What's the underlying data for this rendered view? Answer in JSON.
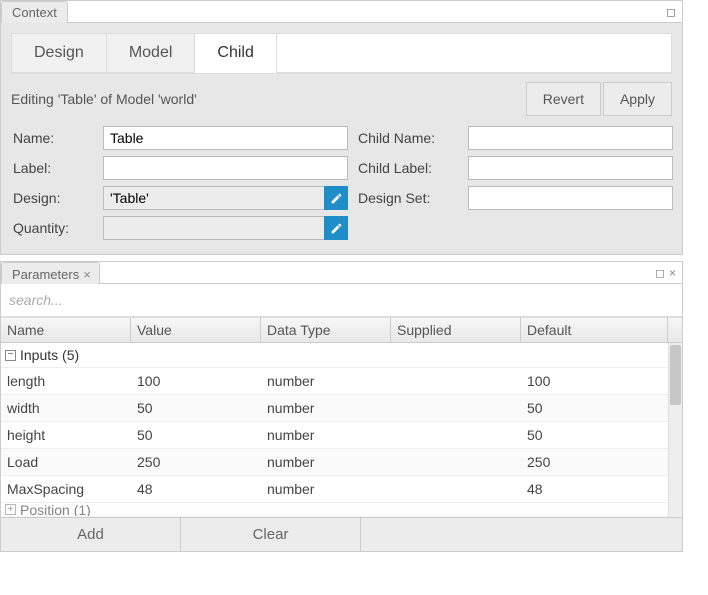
{
  "context": {
    "tab_label": "Context",
    "box_glyph": "◻"
  },
  "inner_tabs": [
    {
      "label": "Design",
      "active": false
    },
    {
      "label": "Model",
      "active": false
    },
    {
      "label": "Child",
      "active": true
    }
  ],
  "editing_text": "Editing 'Table' of Model 'world'",
  "buttons": {
    "revert": "Revert",
    "apply": "Apply",
    "add": "Add",
    "clear": "Clear"
  },
  "fields": {
    "name_label": "Name:",
    "name_value": "Table",
    "label_label": "Label:",
    "label_value": "",
    "design_label": "Design:",
    "design_value": "'Table'",
    "quantity_label": "Quantity:",
    "quantity_value": "",
    "childname_label": "Child Name:",
    "childname_value": "",
    "childlabel_label": "Child Label:",
    "childlabel_value": "",
    "designset_label": "Design Set:",
    "designset_value": ""
  },
  "parameters": {
    "tab_label": "Parameters",
    "search_placeholder": "search...",
    "columns": [
      "Name",
      "Value",
      "Data Type",
      "Supplied",
      "Default"
    ],
    "group_expanded_label": "Inputs (5)",
    "group_collapsed_label": "Position (1)",
    "rows": [
      {
        "name": "length",
        "value": "100",
        "dtype": "number",
        "supplied": "",
        "default": "100"
      },
      {
        "name": "width",
        "value": "50",
        "dtype": "number",
        "supplied": "",
        "default": "50"
      },
      {
        "name": "height",
        "value": "50",
        "dtype": "number",
        "supplied": "",
        "default": "50"
      },
      {
        "name": "Load",
        "value": "250",
        "dtype": "number",
        "supplied": "",
        "default": "250"
      },
      {
        "name": "MaxSpacing",
        "value": "48",
        "dtype": "number",
        "supplied": "",
        "default": "48"
      }
    ]
  },
  "glyphs": {
    "minus": "−",
    "plus": "+",
    "close": "×",
    "box": "◻"
  }
}
